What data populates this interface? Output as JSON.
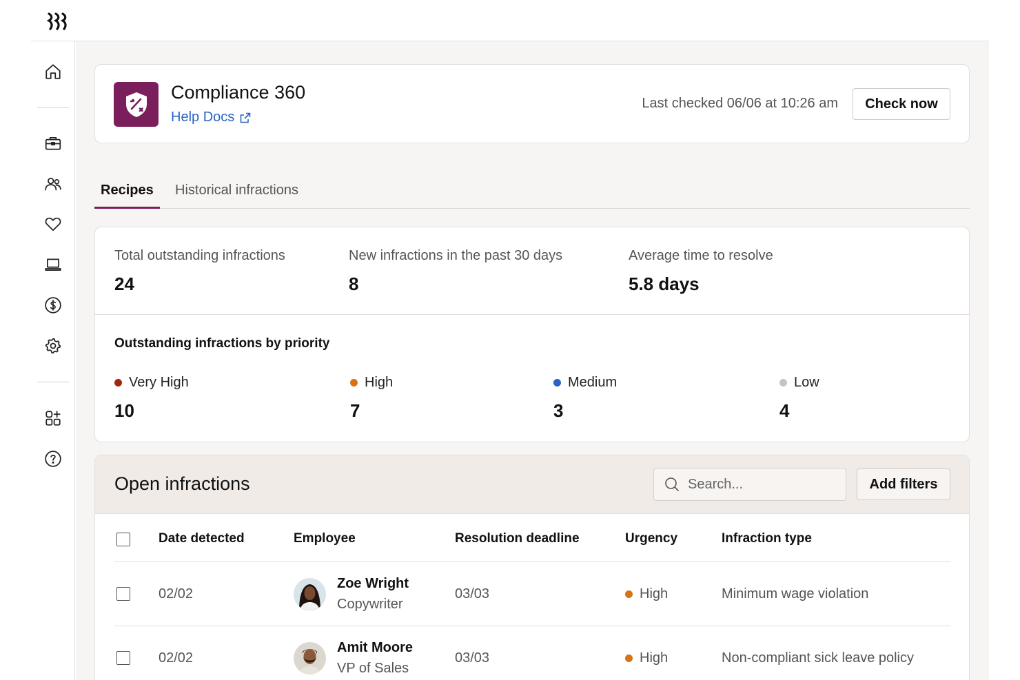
{
  "brand": {
    "logo_icon": "rippling-logo-icon",
    "accent": "#7a1f5c"
  },
  "sidebar": {
    "items": [
      {
        "icon": "home-icon"
      },
      {
        "icon": "briefcase-icon"
      },
      {
        "icon": "people-icon"
      },
      {
        "icon": "heart-icon"
      },
      {
        "icon": "laptop-icon"
      },
      {
        "icon": "dollar-icon"
      },
      {
        "icon": "gear-icon"
      },
      {
        "icon": "apps-add-icon"
      },
      {
        "icon": "help-icon"
      }
    ]
  },
  "header": {
    "app_icon": "shield-percent-icon",
    "title": "Compliance 360",
    "help_link": "Help Docs",
    "last_checked": "Last checked 06/06 at 10:26 am",
    "check_button": "Check now"
  },
  "tabs": [
    {
      "label": "Recipes",
      "active": true
    },
    {
      "label": "Historical infractions",
      "active": false
    }
  ],
  "stats": [
    {
      "label": "Total outstanding infractions",
      "value": "24"
    },
    {
      "label": "New infractions in the past 30 days",
      "value": "8"
    },
    {
      "label": "Average time to resolve",
      "value": "5.8 days"
    }
  ],
  "priority": {
    "heading": "Outstanding infractions by priority",
    "items": [
      {
        "label": "Very High",
        "value": "10",
        "color": "#a3260f"
      },
      {
        "label": "High",
        "value": "7",
        "color": "#d9720f"
      },
      {
        "label": "Medium",
        "value": "3",
        "color": "#2a63c4"
      },
      {
        "label": "Low",
        "value": "4",
        "color": "#c4c4c4"
      }
    ]
  },
  "table": {
    "title": "Open infractions",
    "search_placeholder": "Search...",
    "filter_button": "Add filters",
    "columns": [
      "Date detected",
      "Employee",
      "Resolution deadline",
      "Urgency",
      "Infraction type"
    ],
    "rows": [
      {
        "date": "02/02",
        "name": "Zoe Wright",
        "role": "Copywriter",
        "deadline": "03/03",
        "urgency": "High",
        "urgency_color": "#d9720f",
        "type": "Minimum wage violation"
      },
      {
        "date": "02/02",
        "name": "Amit Moore",
        "role": "VP of Sales",
        "deadline": "03/03",
        "urgency": "High",
        "urgency_color": "#d9720f",
        "type": "Non-compliant sick leave policy"
      }
    ]
  }
}
